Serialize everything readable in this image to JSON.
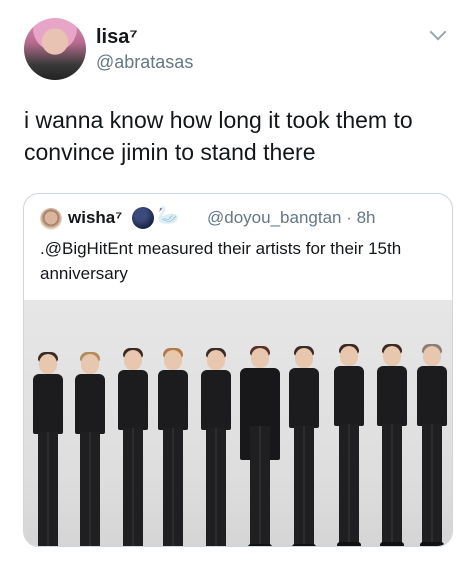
{
  "tweet": {
    "display_name": "lisa⁷",
    "handle": "@abratasas",
    "text": "i wanna know how long it took them to convince jimin to stand there"
  },
  "quote": {
    "display_name": "wisha⁷",
    "emoji": [
      "moon",
      "swan"
    ],
    "handle_time": "@doyou_bangtan · 8h",
    "text": ".@BigHitEnt measured their artists for their 15th anniversary"
  },
  "icons": {
    "menu": "chevron-down-icon",
    "photo": "group-photo"
  }
}
